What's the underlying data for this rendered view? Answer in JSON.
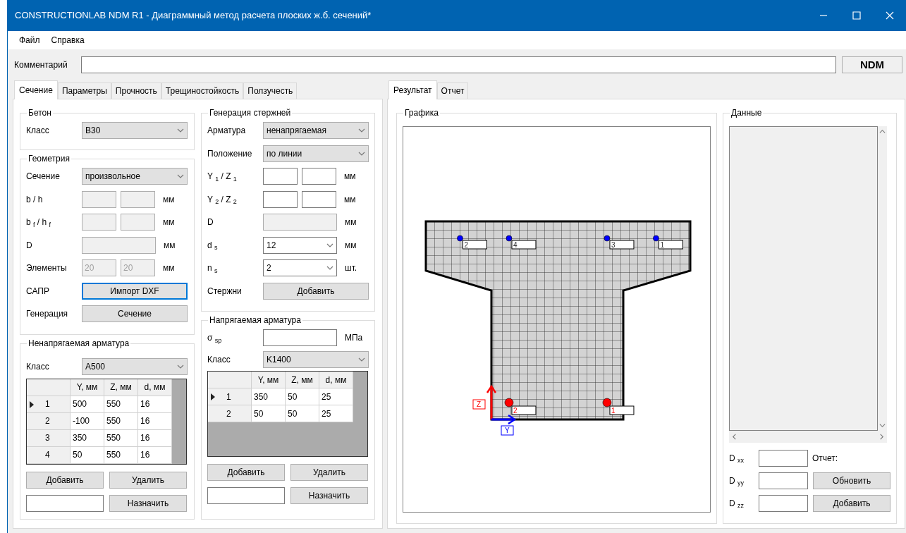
{
  "window": {
    "title": "CONSTRUCTIONLAB NDM R1 - Диаграммный метод расчета плоских ж.б. сечений*"
  },
  "menu": [
    {
      "label": "Файл"
    },
    {
      "label": "Справка"
    }
  ],
  "comment": {
    "label": "Комментарий"
  },
  "ndm_button": "NDM",
  "left_tabs": [
    {
      "label": "Сечение",
      "selected": true
    },
    {
      "label": "Параметры",
      "selected": false
    },
    {
      "label": "Прочность",
      "selected": false
    },
    {
      "label": "Трещиностойкость",
      "selected": false
    },
    {
      "label": "Ползучесть",
      "selected": false
    }
  ],
  "concrete": {
    "title": "Бетон",
    "rows": [
      {
        "kind": "select",
        "label": "Класс",
        "value": "B30"
      }
    ]
  },
  "geometry": {
    "title": "Геометрия",
    "rows": [
      {
        "kind": "select",
        "label": "Сечение",
        "value": "произвольное"
      },
      {
        "kind": "pair",
        "label": "b / h",
        "disabled": true,
        "unit": "мм"
      },
      {
        "kind": "pair",
        "label": "b $_{f}$ / h $_{f}$",
        "disabled": true,
        "unit": "мм"
      },
      {
        "kind": "single",
        "label": "D",
        "disabled": true,
        "unit": "мм"
      },
      {
        "kind": "pair",
        "label": "Элементы",
        "values": [
          "20",
          "20"
        ],
        "disabled": true,
        "unit": "мм"
      },
      {
        "kind": "button",
        "label": "САПР",
        "button": "Импорт DXF",
        "focused": true
      },
      {
        "kind": "button",
        "label": "Генерация",
        "button": "Сечение",
        "focused": false
      }
    ]
  },
  "bar_generation": {
    "title": "Генерация стержней",
    "rows": [
      {
        "kind": "select",
        "label": "Арматура",
        "value": "ненапрягаемая"
      },
      {
        "kind": "select",
        "label": "Положение",
        "value": "по линии"
      },
      {
        "kind": "pair",
        "label": "Y $_{1}$ / Z $_{1}$",
        "disabled": false,
        "unit": "мм"
      },
      {
        "kind": "pair",
        "label": "Y $_{2}$ / Z $_{2}$",
        "disabled": false,
        "unit": "мм"
      },
      {
        "kind": "single",
        "label": "D",
        "disabled": true,
        "unit": "мм"
      },
      {
        "kind": "combo",
        "label": "d $_{s}$",
        "value": "12",
        "unit": "мм"
      },
      {
        "kind": "combo",
        "label": "n $_{s}$",
        "value": "2",
        "unit": "шт."
      },
      {
        "kind": "button",
        "label": "Стержни",
        "button": "Добавить",
        "focused": false
      }
    ]
  },
  "regular_rebar": {
    "title": "Ненапрягаемая арматура",
    "rows": [
      {
        "kind": "select",
        "label": "Класс",
        "value": "A500"
      }
    ],
    "table": {
      "columns": [
        "Y, мм",
        "Z, мм",
        "d, мм"
      ],
      "rows": [
        {
          "index": "1",
          "selected": true,
          "cells": [
            "500",
            "550",
            "16"
          ]
        },
        {
          "index": "2",
          "selected": false,
          "cells": [
            "-100",
            "550",
            "16"
          ]
        },
        {
          "index": "3",
          "selected": false,
          "cells": [
            "350",
            "550",
            "16"
          ]
        },
        {
          "index": "4",
          "selected": false,
          "cells": [
            "50",
            "550",
            "16"
          ]
        }
      ]
    },
    "buttons": [
      "Добавить",
      "Удалить",
      "Назначить"
    ]
  },
  "prestressed_rebar": {
    "title": "Напрягаемая арматура",
    "rows": [
      {
        "kind": "single",
        "label": "σ $_{sp}$",
        "disabled": false,
        "unit": "МПа"
      },
      {
        "kind": "select",
        "label": "Класс",
        "value": "K1400"
      }
    ],
    "table": {
      "columns": [
        "Y, мм",
        "Z, мм",
        "d, мм"
      ],
      "rows": [
        {
          "index": "1",
          "selected": true,
          "cells": [
            "350",
            "50",
            "25"
          ]
        },
        {
          "index": "2",
          "selected": false,
          "cells": [
            "50",
            "50",
            "25"
          ]
        }
      ]
    },
    "buttons": [
      "Добавить",
      "Удалить",
      "Назначить"
    ]
  },
  "right_tabs": [
    {
      "label": "Результат",
      "selected": true
    },
    {
      "label": "Отчет",
      "selected": false
    }
  ],
  "graphics": {
    "title": "Графика",
    "axis_labels": [
      "Z",
      "Y"
    ],
    "rebar_labels": [
      "2",
      "4",
      "3",
      "1"
    ],
    "prestressed_labels": [
      "2",
      "1"
    ]
  },
  "data": {
    "title": "Данные",
    "rows": [
      {
        "kind": "text",
        "label": "D $_{xx}$",
        "text": "Отчет:"
      },
      {
        "kind": "button",
        "label": "D $_{yy}$",
        "button": "Обновить"
      },
      {
        "kind": "button",
        "label": "D $_{zz}$",
        "button": "Добавить"
      }
    ]
  }
}
